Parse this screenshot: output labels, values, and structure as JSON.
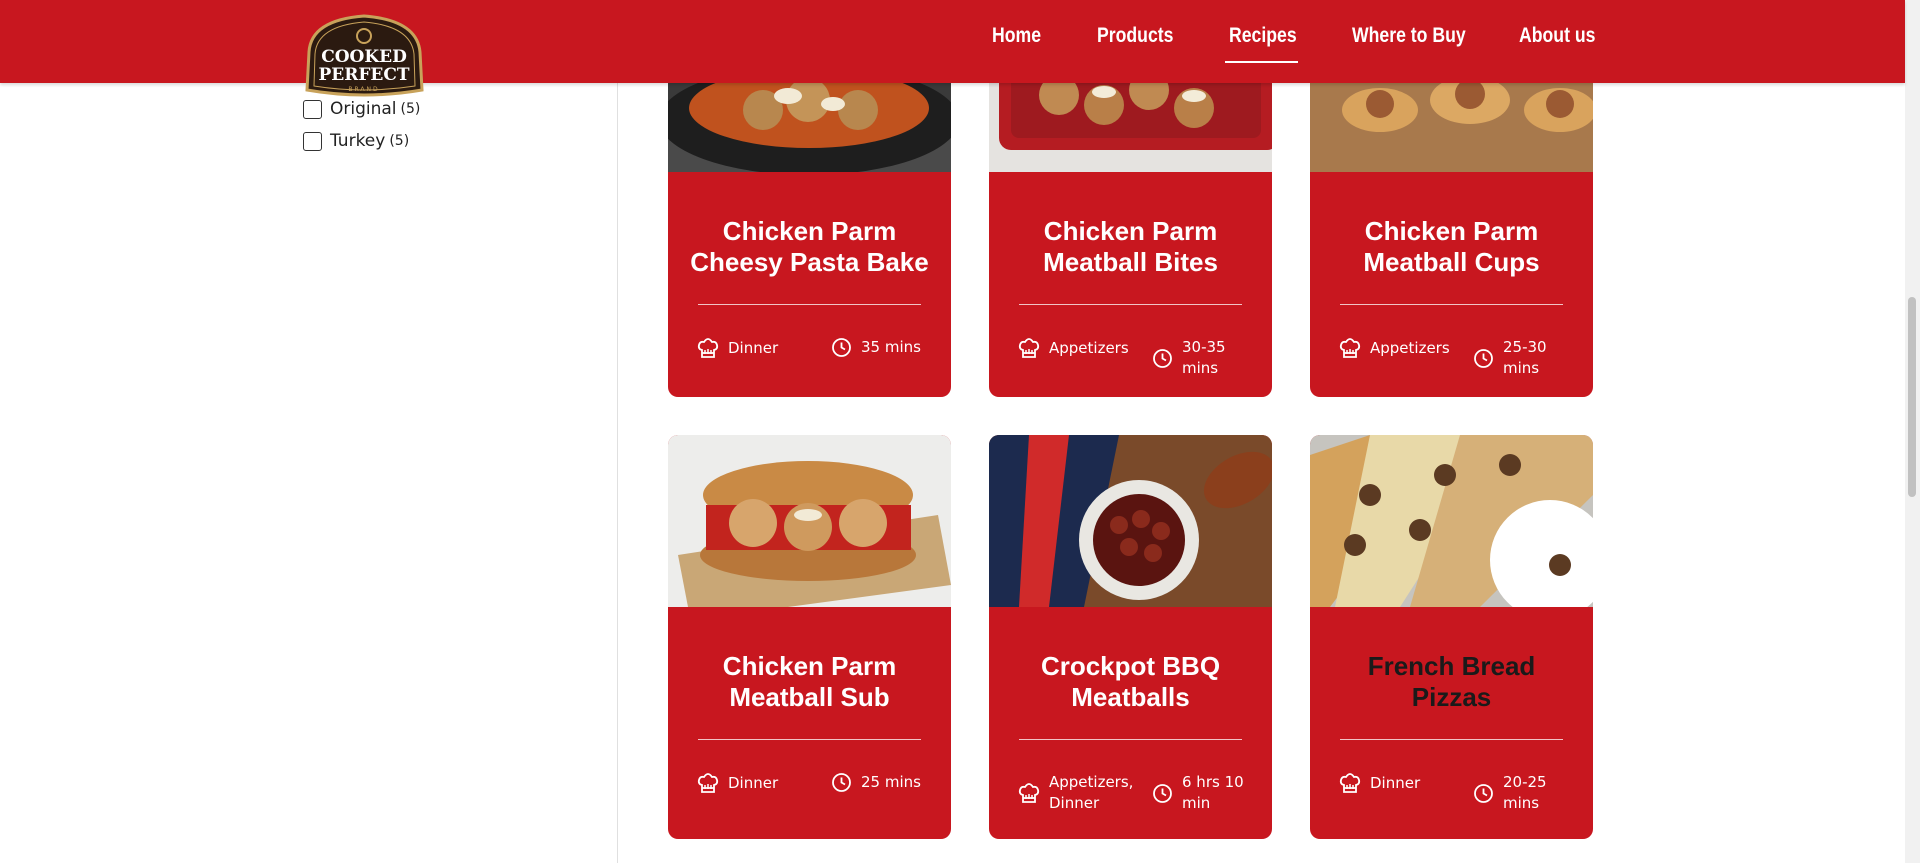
{
  "brand": {
    "logo_line1": "COOKED",
    "logo_line2": "PERFECT",
    "logo_line3": "BRAND"
  },
  "nav": {
    "items": [
      {
        "label": "Home"
      },
      {
        "label": "Products"
      },
      {
        "label": "Recipes",
        "active": true
      },
      {
        "label": "Where to Buy"
      },
      {
        "label": "About us"
      }
    ]
  },
  "filters": {
    "items": [
      {
        "label": "Original",
        "count": "(5)",
        "checked": false
      },
      {
        "label": "Turkey",
        "count": "(5)",
        "checked": false
      }
    ]
  },
  "recipes": [
    {
      "title": "Chicken Parm Cheesy Pasta Bake",
      "category": "Dinner",
      "time": "35 mins"
    },
    {
      "title": "Chicken Parm Meatball Bites",
      "category": "Appetizers",
      "time": "30-35 mins"
    },
    {
      "title": "Chicken Parm Meatball Cups",
      "category": "Appetizers",
      "time": "25-30 mins"
    },
    {
      "title": "Chicken Parm Meatball Sub",
      "category": "Dinner",
      "time": "25 mins"
    },
    {
      "title": "Crockpot BBQ Meatballs",
      "category": "Appetizers, Dinner",
      "time": "6 hrs 10 min"
    },
    {
      "title": "French Bread Pizzas",
      "category": "Dinner",
      "time": "20-25 mins"
    }
  ],
  "colors": {
    "brand_red": "#c8171f",
    "text_dark": "#1a1a1a"
  },
  "icons": {
    "category": "chef-hat-icon",
    "time": "clock-icon"
  }
}
